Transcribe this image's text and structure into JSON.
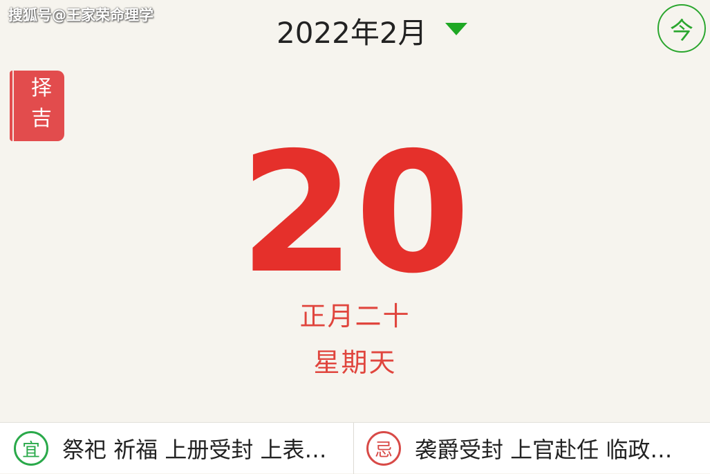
{
  "watermark": "搜狐号@王家荣命理学",
  "header": {
    "month_label": "2022年2月",
    "dropdown_icon": "dropdown-arrow-icon",
    "today_label": "今"
  },
  "side_tab": {
    "label": "择吉"
  },
  "date": {
    "day": "20",
    "lunar": "正月二十",
    "weekday": "星期天"
  },
  "bottom": {
    "yi": {
      "seal": "宜",
      "text": "祭祀 祈福 上册受封 上表…"
    },
    "ji": {
      "seal": "忌",
      "text": "袭爵受封 上官赴任 临政…"
    }
  },
  "colors": {
    "background": "#f6f4ee",
    "accent_green": "#2aa62e",
    "accent_red": "#e5302b"
  }
}
